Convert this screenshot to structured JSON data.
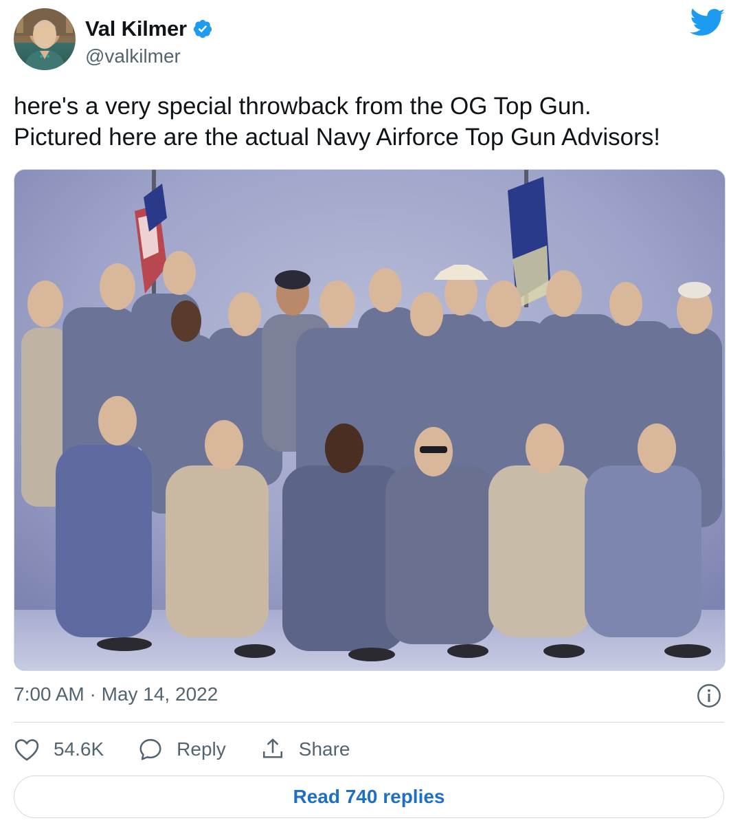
{
  "author": {
    "display_name": "Val Kilmer",
    "handle": "@valkilmer",
    "verified": true
  },
  "tweet": {
    "text_lines": [
      "here's a very special throwback from the OG Top Gun.",
      "Pictured here are the actual Navy Airforce Top Gun Advisors!"
    ],
    "timestamp": "7:00 AM · May 14, 2022"
  },
  "actions": {
    "like_count": "54.6K",
    "reply_label": "Reply",
    "share_label": "Share"
  },
  "read_replies_label": "Read 740 replies",
  "icons": {
    "platform": "twitter-bird-icon",
    "verified": "verified-badge-icon",
    "info": "info-icon",
    "like": "heart-icon",
    "reply": "speech-bubble-icon",
    "share": "share-upload-icon"
  },
  "colors": {
    "brand": "#1d9bf0",
    "link": "#1d70c8",
    "text": "#0f1419",
    "muted": "#536471",
    "border": "#cfd9de"
  }
}
